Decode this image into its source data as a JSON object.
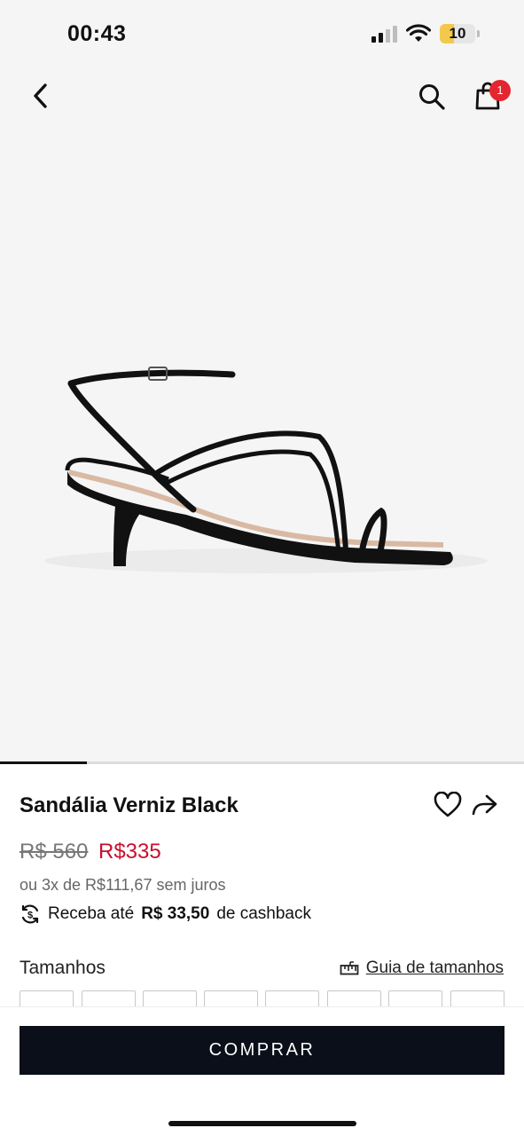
{
  "status_bar": {
    "time": "00:43",
    "battery_level": "10",
    "icons": [
      "cellular-signal-icon",
      "wifi-icon",
      "battery-icon"
    ]
  },
  "nav": {
    "icons": [
      "chevron-left-icon",
      "search-icon",
      "shopping-bag-icon"
    ],
    "cart_count": "1"
  },
  "gallery": {
    "product_image": "black-patent-strappy-kitten-heel-sandal",
    "progress": 0.166
  },
  "product": {
    "title": "Sandália Verniz Black",
    "old_price": "R$ 560",
    "new_price": "R$335",
    "installments": "ou 3x de R$111,67 sem juros",
    "cashback_prefix": "Receba até",
    "cashback_amount": "R$ 33,50",
    "cashback_suffix": "de cashback",
    "actions": [
      "heart-icon",
      "share-icon"
    ]
  },
  "sizes": {
    "title": "Tamanhos",
    "guide_label": "Guia de tamanhos",
    "guide_icon": "ruler-icon",
    "visible_option_count": 8
  },
  "cta": {
    "buy_label": "COMPRAR"
  },
  "colors": {
    "accent_sale": "#c8102e",
    "badge": "#e3262f",
    "cta_background": "#0b0f19",
    "image_background": "#f5f5f5"
  }
}
